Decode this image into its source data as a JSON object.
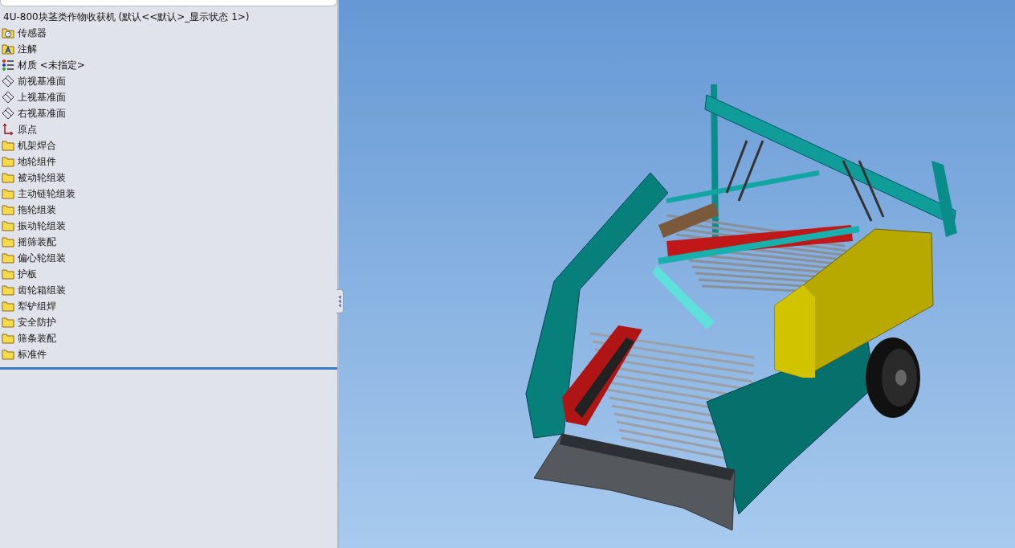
{
  "tree": {
    "title": "4U-800块茎类作物收获机 (默认<<默认>_显示状态 1>)",
    "items": [
      {
        "kind": "sensor",
        "label": "传感器"
      },
      {
        "kind": "annotation",
        "label": "注解"
      },
      {
        "kind": "material",
        "label": "材质 <未指定>"
      },
      {
        "kind": "plane",
        "label": "前视基准面"
      },
      {
        "kind": "plane",
        "label": "上视基准面"
      },
      {
        "kind": "plane",
        "label": "右视基准面"
      },
      {
        "kind": "origin",
        "label": "原点"
      },
      {
        "kind": "folder",
        "label": "机架焊合"
      },
      {
        "kind": "folder",
        "label": "地轮组件"
      },
      {
        "kind": "folder",
        "label": "被动轮组装"
      },
      {
        "kind": "folder",
        "label": "主动链轮组装"
      },
      {
        "kind": "folder",
        "label": "拖轮组装"
      },
      {
        "kind": "folder",
        "label": "振动轮组装"
      },
      {
        "kind": "folder",
        "label": "摇筛装配"
      },
      {
        "kind": "folder",
        "label": "偏心轮组装"
      },
      {
        "kind": "folder",
        "label": "护板"
      },
      {
        "kind": "folder",
        "label": "齿轮箱组装"
      },
      {
        "kind": "folder",
        "label": "犁铲组焊"
      },
      {
        "kind": "folder",
        "label": "安全防护"
      },
      {
        "kind": "folder",
        "label": "筛条装配"
      },
      {
        "kind": "folder",
        "label": "标准件"
      }
    ]
  }
}
